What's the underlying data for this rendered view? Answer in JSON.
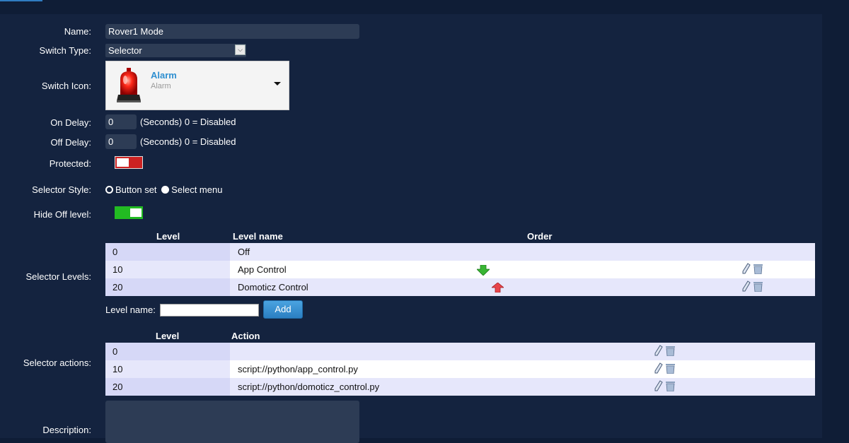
{
  "form": {
    "name_label": "Name:",
    "name_value": "Rover1 Mode",
    "switch_type_label": "Switch Type:",
    "switch_type_value": "Selector",
    "switch_icon_label": "Switch Icon:",
    "icon_title": "Alarm",
    "icon_subtitle": "Alarm",
    "on_delay_label": "On Delay:",
    "on_delay_value": "0",
    "on_delay_hint": "(Seconds) 0 = Disabled",
    "off_delay_label": "Off Delay:",
    "off_delay_value": "0",
    "off_delay_hint": "(Seconds) 0 = Disabled",
    "protected_label": "Protected:",
    "protected_on": false,
    "selector_style_label": "Selector Style:",
    "selector_style_options": [
      "Button set",
      "Select menu"
    ],
    "selector_style_selected": "Select menu",
    "hide_off_label": "Hide Off level:",
    "hide_off_on": true,
    "selector_levels_label": "Selector Levels:",
    "level_name_label": "Level name:",
    "level_name_value": "",
    "add_label": "Add",
    "selector_actions_label": "Selector actions:",
    "description_label": "Description:"
  },
  "levels_table": {
    "headers": [
      "Level",
      "Level name",
      "Order"
    ],
    "rows": [
      {
        "level": "0",
        "name": "Off",
        "order": ""
      },
      {
        "level": "10",
        "name": "App Control",
        "order": "down"
      },
      {
        "level": "20",
        "name": "Domoticz Control",
        "order": "up"
      }
    ]
  },
  "actions_table": {
    "headers": [
      "Level",
      "Action"
    ],
    "rows": [
      {
        "level": "0",
        "action": ""
      },
      {
        "level": "10",
        "action": "script://python/app_control.py"
      },
      {
        "level": "20",
        "action": "script://python/domoticz_control.py"
      }
    ]
  },
  "colors": {
    "background": "#0f1d36",
    "panel": "#14233f",
    "toggle_off": "#cc2222",
    "toggle_on": "#22bb22",
    "accent": "#2f8fd0"
  },
  "icons": {
    "switch_icon": "alarm-siren-icon",
    "order_down": "green-arrow-down-icon",
    "order_up": "red-arrow-up-icon",
    "edit": "pencil-icon",
    "delete": "trash-icon"
  }
}
